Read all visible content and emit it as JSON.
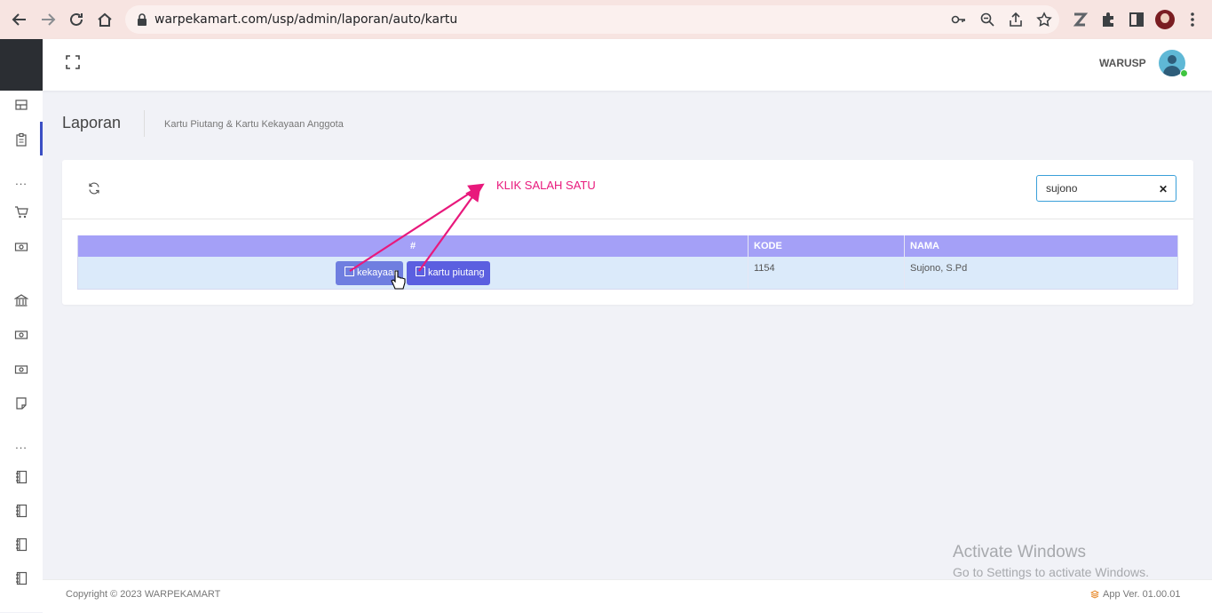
{
  "browser": {
    "url": "warpekamart.com/usp/admin/laporan/auto/kartu"
  },
  "header": {
    "username": "WARUSP"
  },
  "page": {
    "title": "Laporan",
    "subtitle": "Kartu Piutang & Kartu Kekayaan Anggota"
  },
  "search": {
    "value": "sujono"
  },
  "table": {
    "columns": [
      "#",
      "KODE",
      "NAMA"
    ],
    "rows": [
      {
        "buttons": [
          "kekayaan",
          "kartu piutang"
        ],
        "kode": "1154",
        "nama": "Sujono, S.Pd"
      }
    ]
  },
  "annotation": {
    "text": "KLIK SALAH SATU",
    "color": "#e8197c"
  },
  "watermark": {
    "line1": "Activate Windows",
    "line2": "Go to Settings to activate Windows."
  },
  "footer": {
    "copyright": "Copyright © 2023 WARPEKAMART",
    "app_version": "App Ver. 01.00.01"
  },
  "colors": {
    "table_header": "#a4a0f7",
    "row_bg": "#dbeafa",
    "btn_kekayaan": "#6f7ee0",
    "btn_piutang": "#5b5fe0"
  }
}
